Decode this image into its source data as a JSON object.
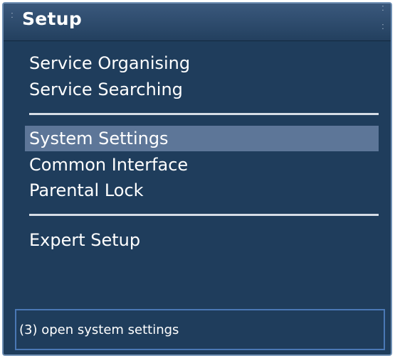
{
  "window": {
    "title": "Setup"
  },
  "menu": {
    "groups": [
      {
        "items": [
          "Service Organising",
          "Service Searching"
        ]
      },
      {
        "items": [
          "System Settings",
          "Common Interface",
          "Parental Lock"
        ]
      },
      {
        "items": [
          "Expert Setup"
        ]
      }
    ],
    "selected": "System Settings"
  },
  "status": {
    "text": "(3) open system settings"
  },
  "colors": {
    "background": "#1f3d5c",
    "selection": "#5d7698",
    "separator": "#d6dde6",
    "status_border": "#4a78b5",
    "text": "#ffffff"
  },
  "icons": {
    "title_left": "grip-dots-icon",
    "title_right": "grip-dots-icon"
  }
}
